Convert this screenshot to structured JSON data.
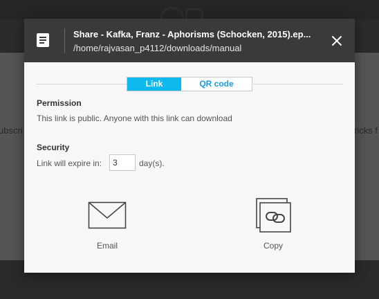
{
  "background": {
    "left_fragment": "ubscri",
    "right_fragment": "ricks f"
  },
  "dialog": {
    "title": "Share - Kafka, Franz - Aphorisms (Schocken, 2015).ep...",
    "path": "/home/rajvasan_p4112/downloads/manual",
    "icons": {
      "file": "document-icon",
      "close": "close-icon"
    },
    "tabs": [
      {
        "label": "Link",
        "active": true
      },
      {
        "label": "QR code",
        "active": false
      }
    ],
    "permission": {
      "title": "Permission",
      "text": "This link is public. Anyone with this link can download"
    },
    "security": {
      "title": "Security",
      "expire_label": "Link will expire in:",
      "expire_value": "3",
      "unit": "day(s)."
    },
    "actions": [
      {
        "label": "Email",
        "icon": "envelope-icon"
      },
      {
        "label": "Copy",
        "icon": "copy-link-icon"
      }
    ],
    "colors": {
      "header": "#3a3a3c",
      "accent": "#10b8f0",
      "tab_text": "#1a9ad6"
    }
  }
}
